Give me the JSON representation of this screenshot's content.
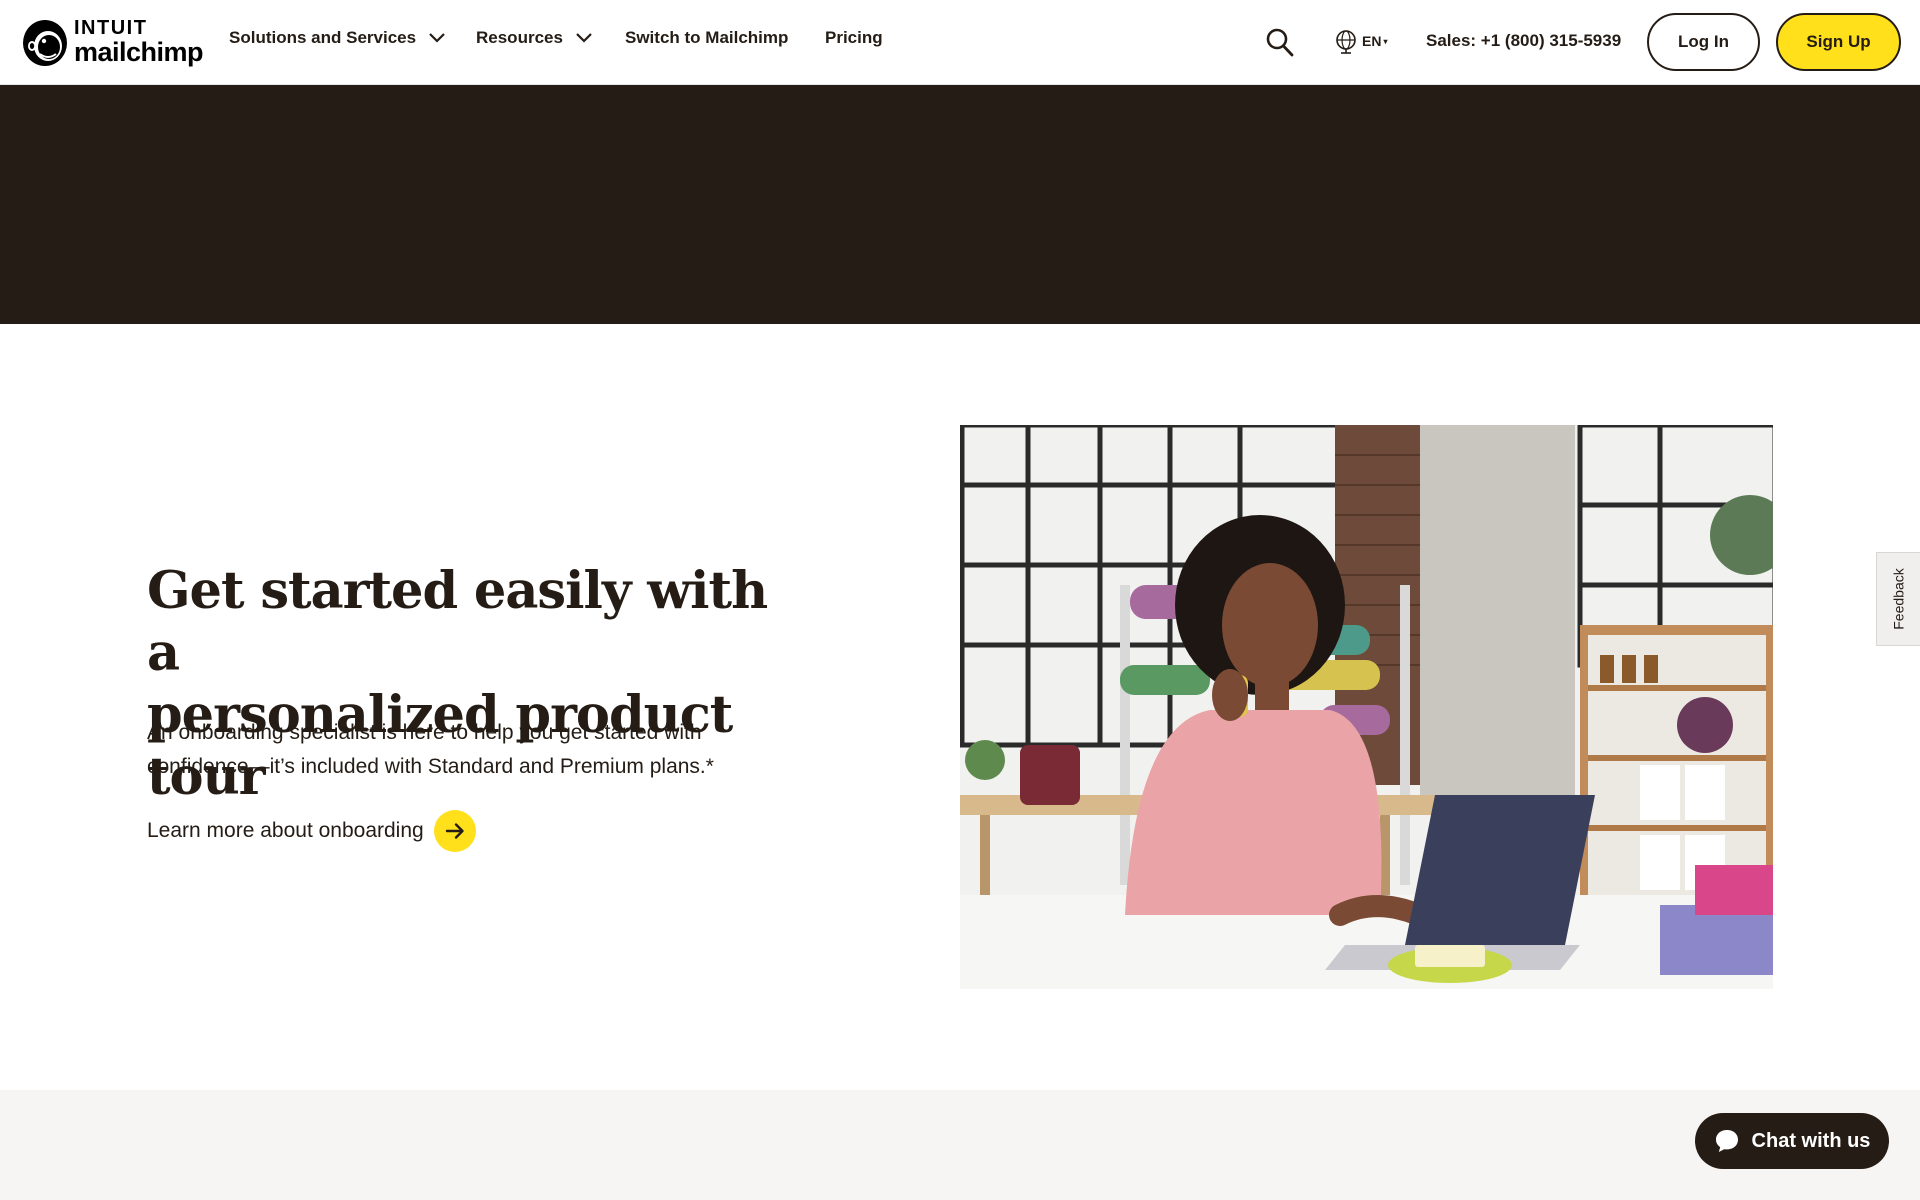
{
  "brand": {
    "name_top": "INTUIT",
    "name_bottom": "mailchimp",
    "accent": "#ffe01b",
    "dark": "#241c15"
  },
  "nav": {
    "solutions": "Solutions and Services",
    "resources": "Resources",
    "switch": "Switch to Mailchimp",
    "pricing": "Pricing"
  },
  "header_right": {
    "search_icon": "search-icon",
    "language": "EN",
    "sales": "Sales: +1 (800) 315-5939",
    "login": "Log In",
    "signup": "Sign Up"
  },
  "hero": {
    "headline_line1": "Get started easily with a",
    "headline_line2": "personalized product tour",
    "body_line1": "An onboarding specialist is here to help you get started with",
    "body_line2": "confidence—it’s included with Standard and Premium plans.*",
    "cta": "Learn more about onboarding"
  },
  "feedback": "Feedback",
  "chat": "Chat with us"
}
